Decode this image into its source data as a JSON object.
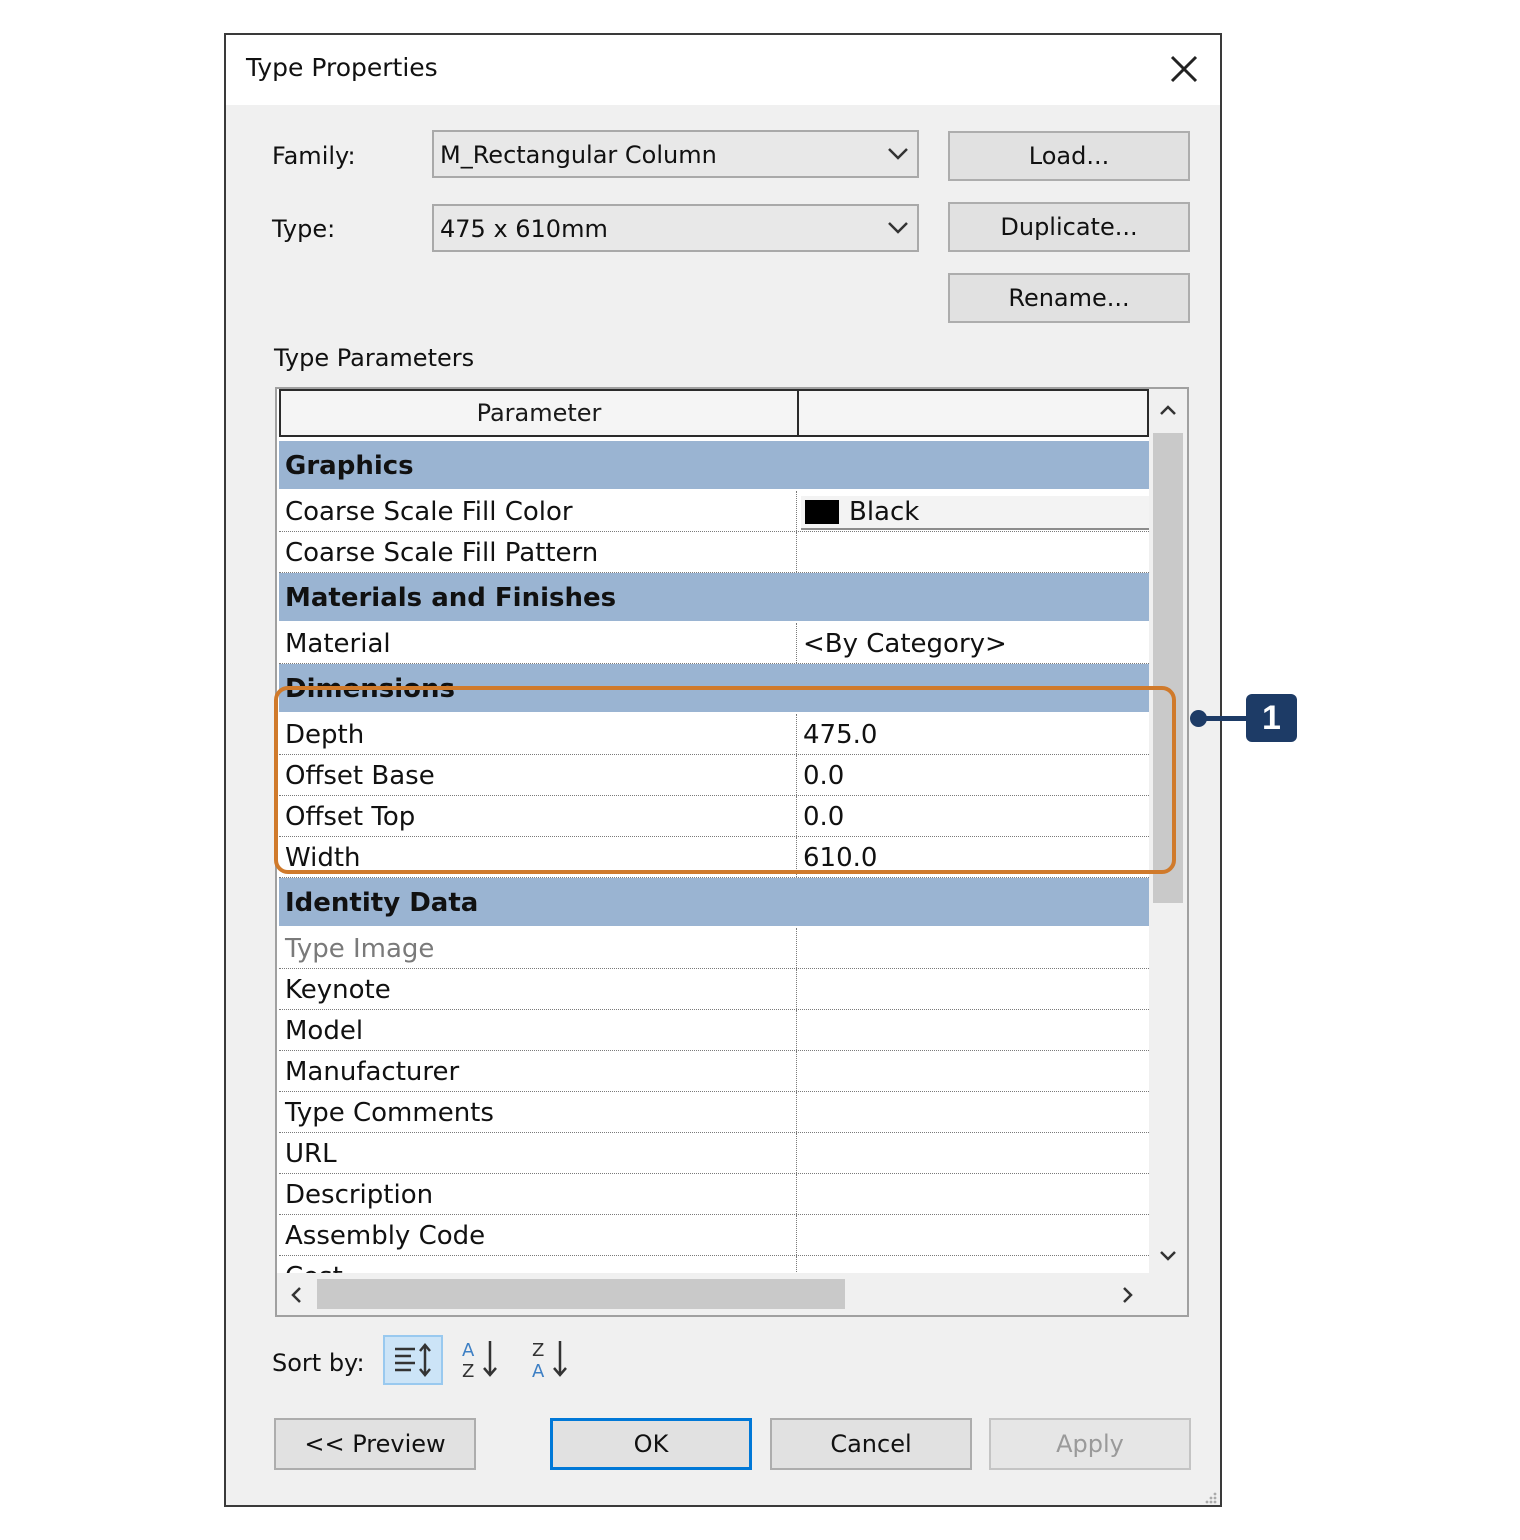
{
  "dialog": {
    "title": "Type Properties",
    "family_label": "Family:",
    "family_value": "M_Rectangular Column",
    "type_label": "Type:",
    "type_value": "475 x 610mm",
    "load_label": "Load...",
    "duplicate_label": "Duplicate...",
    "rename_label": "Rename...",
    "type_parameters_label": "Type Parameters",
    "sort_by_label": "Sort by:",
    "preview_label": "<< Preview",
    "ok_label": "OK",
    "cancel_label": "Cancel",
    "apply_label": "Apply"
  },
  "grid": {
    "header_parameter": "Parameter",
    "header_value": "",
    "rows": [
      {
        "kind": "group",
        "name": "Graphics"
      },
      {
        "kind": "param",
        "name": "Coarse Scale Fill Color",
        "value": "Black",
        "swatch": "#000000"
      },
      {
        "kind": "param",
        "name": "Coarse Scale Fill Pattern",
        "value": ""
      },
      {
        "kind": "group",
        "name": "Materials and Finishes"
      },
      {
        "kind": "param",
        "name": "Material",
        "value": "<By Category>"
      },
      {
        "kind": "group",
        "name": "Dimensions"
      },
      {
        "kind": "param",
        "name": "Depth",
        "value": "475.0"
      },
      {
        "kind": "param",
        "name": "Offset Base",
        "value": "0.0"
      },
      {
        "kind": "param",
        "name": "Offset Top",
        "value": "0.0"
      },
      {
        "kind": "param",
        "name": "Width",
        "value": "610.0"
      },
      {
        "kind": "group",
        "name": "Identity Data"
      },
      {
        "kind": "param",
        "name": "Type Image",
        "value": "",
        "muted": true
      },
      {
        "kind": "param",
        "name": "Keynote",
        "value": ""
      },
      {
        "kind": "param",
        "name": "Model",
        "value": ""
      },
      {
        "kind": "param",
        "name": "Manufacturer",
        "value": ""
      },
      {
        "kind": "param",
        "name": "Type Comments",
        "value": ""
      },
      {
        "kind": "param",
        "name": "URL",
        "value": ""
      },
      {
        "kind": "param",
        "name": "Description",
        "value": ""
      },
      {
        "kind": "param",
        "name": "Assembly Code",
        "value": ""
      },
      {
        "kind": "param",
        "name": "Cost",
        "value": ""
      }
    ]
  },
  "callout": {
    "number": "1"
  },
  "colors": {
    "group_band": "#9ab4d2",
    "highlight": "#d07a2b",
    "callout": "#1d3b66",
    "primary_border": "#0078d7"
  }
}
